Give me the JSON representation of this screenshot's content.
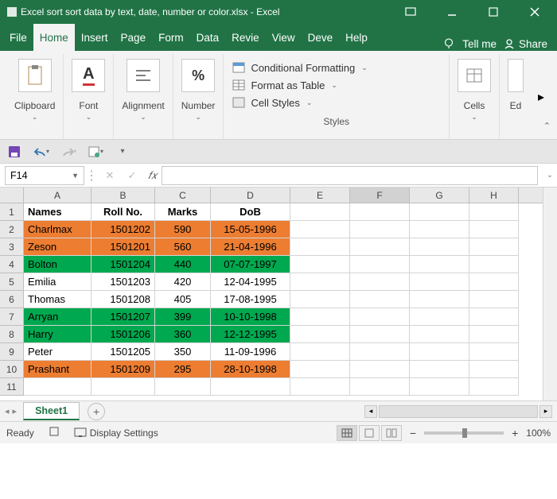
{
  "titlebar": {
    "title": "Excel sort sort data by text, date, number or color.xlsx  -  Excel"
  },
  "tabs": {
    "items": [
      "File",
      "Home",
      "Insert",
      "Page",
      "Form",
      "Data",
      "Revie",
      "View",
      "Deve",
      "Help"
    ],
    "tellme": "Tell me",
    "share": "Share"
  },
  "ribbon": {
    "groups": {
      "clipboard": "Clipboard",
      "font": "Font",
      "alignment": "Alignment",
      "number": "Number",
      "styles": "Styles",
      "cells": "Cells",
      "editing": "Ed"
    },
    "styles_items": {
      "cond": "Conditional Formatting",
      "table": "Format as Table",
      "cell": "Cell Styles"
    }
  },
  "namebox": "F14",
  "columns": [
    "A",
    "B",
    "C",
    "D",
    "E",
    "F",
    "G",
    "H"
  ],
  "col_widths": [
    "w-A",
    "w-B",
    "w-C",
    "w-D",
    "w-E",
    "w-F",
    "w-G",
    "w-H"
  ],
  "selected_col": "F",
  "headers": [
    "Names",
    "Roll No.",
    "Marks",
    "DoB"
  ],
  "rows": [
    {
      "n": 1,
      "cells": [
        "Names",
        "Roll No.",
        "Marks",
        "DoB"
      ],
      "header": true,
      "fill": ""
    },
    {
      "n": 2,
      "cells": [
        "Charlmax",
        "1501202",
        "590",
        "15-05-1996"
      ],
      "fill": "orange"
    },
    {
      "n": 3,
      "cells": [
        "Zeson",
        "1501201",
        "560",
        "21-04-1996"
      ],
      "fill": "orange"
    },
    {
      "n": 4,
      "cells": [
        "Bolton",
        "1501204",
        "440",
        "07-07-1997"
      ],
      "fill": "green"
    },
    {
      "n": 5,
      "cells": [
        "Emilia",
        "1501203",
        "420",
        "12-04-1995"
      ],
      "fill": ""
    },
    {
      "n": 6,
      "cells": [
        "Thomas",
        "1501208",
        "405",
        "17-08-1995"
      ],
      "fill": ""
    },
    {
      "n": 7,
      "cells": [
        "Arryan",
        "1501207",
        "399",
        "10-10-1998"
      ],
      "fill": "green"
    },
    {
      "n": 8,
      "cells": [
        "Harry",
        "1501206",
        "360",
        "12-12-1995"
      ],
      "fill": "green"
    },
    {
      "n": 9,
      "cells": [
        "Peter",
        "1501205",
        "350",
        "11-09-1996"
      ],
      "fill": ""
    },
    {
      "n": 10,
      "cells": [
        "Prashant",
        "1501209",
        "295",
        "28-10-1998"
      ],
      "fill": "orange"
    },
    {
      "n": 11,
      "cells": [
        "",
        "",
        "",
        ""
      ],
      "fill": ""
    }
  ],
  "sheet": {
    "active": "Sheet1"
  },
  "status": {
    "ready": "Ready",
    "display": "Display Settings",
    "zoom": "100%"
  }
}
